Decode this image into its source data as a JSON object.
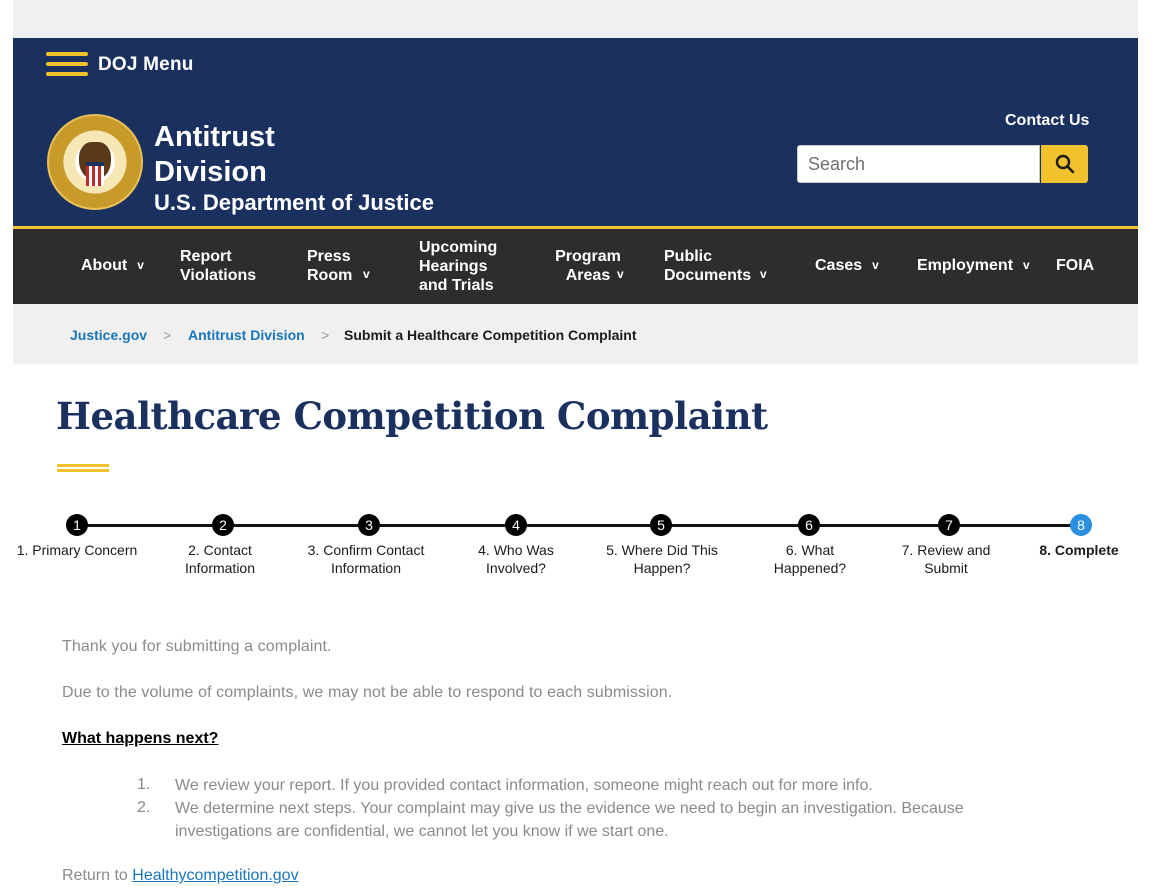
{
  "header": {
    "menu_label": "DOJ Menu",
    "division_title": "Antitrust Division",
    "department": "U.S. Department of Justice",
    "contact_label": "Contact Us",
    "search_placeholder": "Search"
  },
  "nav": {
    "items": [
      {
        "label": "About",
        "chevron": "v"
      },
      {
        "label": "Report Violations"
      },
      {
        "label": "Press Room",
        "chevron": "v"
      },
      {
        "label": "Upcoming Hearings and Trials"
      },
      {
        "label": "Program Areas",
        "chevron": "v"
      },
      {
        "label": "Public Documents",
        "chevron": "v"
      },
      {
        "label": "Cases",
        "chevron": "v"
      },
      {
        "label": "Employment",
        "chevron": "v"
      },
      {
        "label": "FOIA"
      }
    ]
  },
  "breadcrumb": {
    "items": [
      "Justice.gov",
      "Antitrust Division",
      "Submit a Healthcare Competition Complaint"
    ],
    "separator": ">"
  },
  "page": {
    "title": "Healthcare Competition Complaint"
  },
  "stepper": {
    "active_step": 8,
    "steps": [
      {
        "num": "1",
        "label": "1. Primary Concern"
      },
      {
        "num": "2",
        "label": "2. Contact Information"
      },
      {
        "num": "3",
        "label": "3. Confirm Contact Information"
      },
      {
        "num": "4",
        "label": "4. Who Was Involved?"
      },
      {
        "num": "5",
        "label": "5. Where Did This Happen?"
      },
      {
        "num": "6",
        "label": "6. What Happened?"
      },
      {
        "num": "7",
        "label": "7. Review and Submit"
      },
      {
        "num": "8",
        "label": "8. Complete"
      }
    ]
  },
  "content": {
    "thanks": "Thank you for submitting a complaint.",
    "volume_note": "Due to the volume of complaints, we may not be able to respond to each submission.",
    "next_heading": "What happens next?",
    "next_steps": [
      {
        "num": "1.",
        "text": "We review your report. If you provided contact information, someone might reach out for more info."
      },
      {
        "num": "2.",
        "text": "We determine next steps. Your complaint may give us the evidence we need to begin an investigation. Because investigations are confidential, we cannot let you know if we start one."
      }
    ],
    "return_prefix": "Return to",
    "return_link": "Healthycompetition.gov"
  },
  "colors": {
    "header_bg": "#1a3160",
    "accent": "#f2c12e",
    "nav_bg": "#2d2d2b",
    "link": "#1a75bb",
    "active_step": "#2a8fe0"
  }
}
